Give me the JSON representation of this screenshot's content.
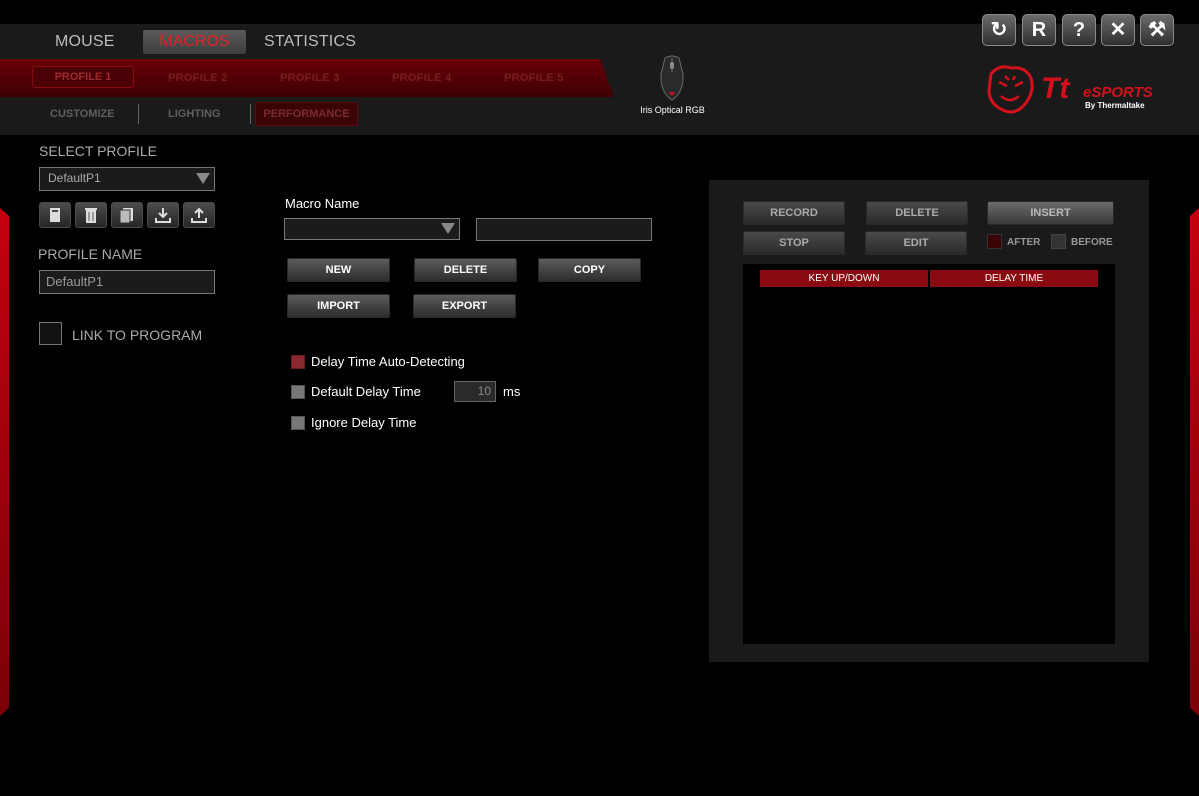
{
  "main_tabs": [
    {
      "label": "MOUSE"
    },
    {
      "label": "MACROS"
    },
    {
      "label": "STATISTICS"
    }
  ],
  "profiles": [
    {
      "label": "PROFILE 1"
    },
    {
      "label": "PROFILE 2"
    },
    {
      "label": "PROFILE 3"
    },
    {
      "label": "PROFILE 4"
    },
    {
      "label": "PROFILE 5"
    }
  ],
  "sub_tabs": [
    {
      "label": "CUSTOMIZE"
    },
    {
      "label": "LIGHTING"
    },
    {
      "label": "PERFORMANCE"
    }
  ],
  "device": {
    "name": "Iris Optical RGB"
  },
  "brand": {
    "logo_main": "Tt",
    "logo_sub": "eSPORTS",
    "logo_by": "By Thermaltake",
    "accent": "#d4101c"
  },
  "window_buttons": [
    {
      "icon": "refresh-icon",
      "glyph": "↻"
    },
    {
      "icon": "reset-icon",
      "glyph": "R"
    },
    {
      "icon": "help-icon",
      "glyph": "?"
    },
    {
      "icon": "close-icon",
      "glyph": "✕"
    },
    {
      "icon": "tools-icon",
      "glyph": "⚒"
    }
  ],
  "left_panel": {
    "select_profile_label": "SELECT PROFILE",
    "selected_profile": "DefaultP1",
    "profile_name_label": "PROFILE NAME",
    "profile_name_value": "DefaultP1",
    "link_label": "LINK TO PROGRAM"
  },
  "macro": {
    "name_label": "Macro Name",
    "selected": "",
    "name_value": "",
    "buttons": {
      "new": "NEW",
      "delete": "DELETE",
      "copy": "COPY",
      "import": "IMPORT",
      "export": "EXPORT"
    },
    "options": {
      "auto_detect": "Delay Time Auto-Detecting",
      "default_delay": "Default Delay Time",
      "default_delay_value": "10",
      "default_delay_unit": "ms",
      "ignore_delay": "Ignore Delay Time"
    }
  },
  "recorder": {
    "record": "RECORD",
    "delete": "DELETE",
    "insert": "INSERT",
    "stop": "STOP",
    "edit": "EDIT",
    "after": "AFTER",
    "before": "BEFORE",
    "columns": [
      "KEY UP/DOWN",
      "DELAY TIME"
    ]
  }
}
